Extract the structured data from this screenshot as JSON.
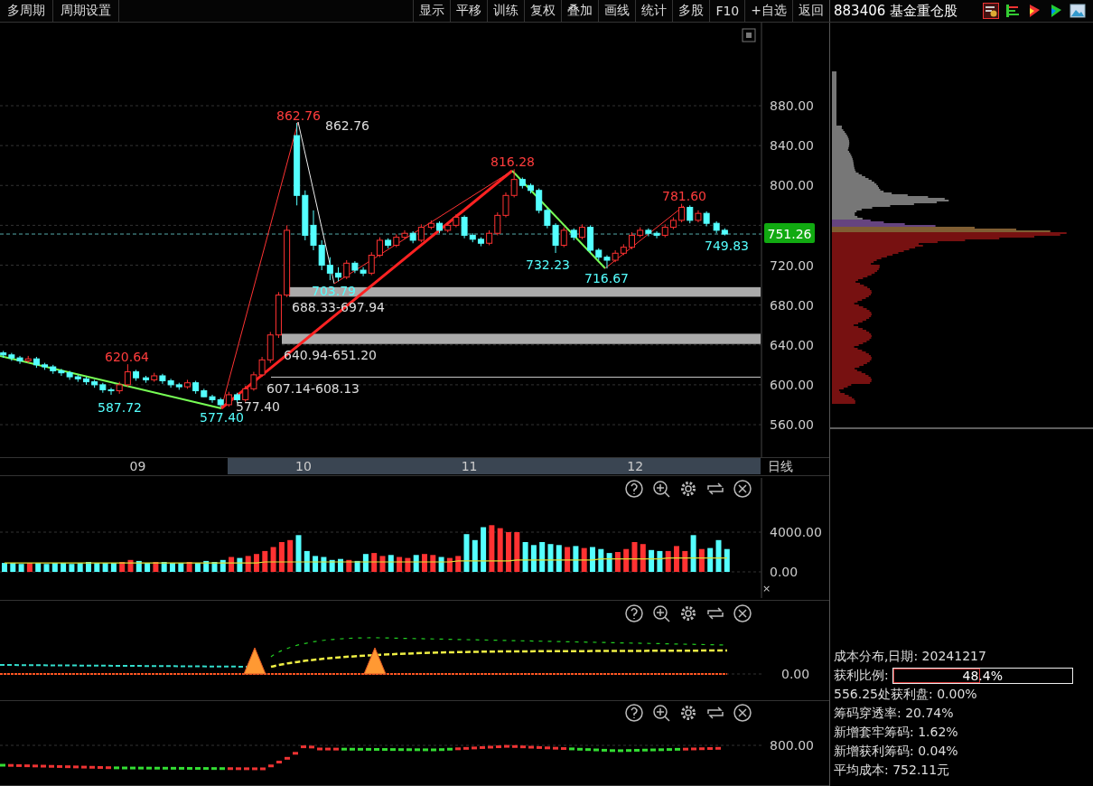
{
  "toolbar": {
    "left_items": [
      {
        "label": "多周期"
      },
      {
        "label": "周期设置"
      }
    ],
    "buttons": [
      "显示",
      "平移",
      "训练",
      "复权",
      "叠加",
      "画线",
      "统计",
      "多股",
      "F10",
      "+自选",
      "返回"
    ],
    "security": {
      "code": "883406",
      "name": "基金重仓股"
    }
  },
  "price_panel": {
    "chart_data": {
      "type": "candlestick",
      "x": [
        8.19,
        8.24,
        8.29,
        8.34,
        8.39,
        8.44,
        8.49,
        8.54,
        8.59,
        8.64,
        8.69,
        8.74,
        8.79,
        8.84,
        8.89,
        8.94,
        8.99,
        9.05,
        9.1,
        9.15,
        9.2,
        9.25,
        9.3,
        9.35,
        9.4,
        9.45,
        9.5,
        9.55,
        9.6,
        9.65,
        9.7,
        9.75,
        9.8,
        9.85,
        9.9,
        9.96,
        10.01,
        10.06,
        10.11,
        10.16,
        10.21,
        10.26,
        10.31,
        10.36,
        10.41,
        10.46,
        10.51,
        10.56,
        10.61,
        10.66,
        10.71,
        10.77,
        10.82,
        10.87,
        10.92,
        10.97,
        11.02,
        11.07,
        11.12,
        11.17,
        11.22,
        11.27,
        11.32,
        11.37,
        11.42,
        11.47,
        11.52,
        11.57,
        11.63,
        11.68,
        11.73,
        11.78,
        11.83,
        11.88,
        11.93,
        11.98,
        12.03,
        12.08,
        12.13,
        12.18,
        12.23,
        12.28,
        12.33,
        12.38,
        12.43,
        12.49,
        12.54
      ],
      "ohlc": [
        [
          632,
          634,
          627,
          630
        ],
        [
          630,
          632,
          624,
          627
        ],
        [
          627,
          629,
          621,
          624
        ],
        [
          624,
          629,
          622,
          626
        ],
        [
          626,
          628,
          617,
          620
        ],
        [
          620,
          622,
          615,
          618
        ],
        [
          618,
          620,
          611,
          614
        ],
        [
          614,
          616,
          609,
          612
        ],
        [
          612,
          614,
          605,
          608
        ],
        [
          608,
          610,
          603,
          606
        ],
        [
          606,
          608,
          600,
          603
        ],
        [
          603,
          605,
          597,
          600
        ],
        [
          600,
          602,
          592,
          595
        ],
        [
          595,
          597,
          590,
          594
        ],
        [
          594,
          603,
          591,
          600
        ],
        [
          600,
          620.64,
          598,
          613
        ],
        [
          613,
          615,
          604,
          607
        ],
        [
          607,
          609,
          602,
          605
        ],
        [
          605,
          612,
          603,
          609
        ],
        [
          609,
          611,
          601,
          604
        ],
        [
          604,
          606,
          597,
          600
        ],
        [
          600,
          602,
          595,
          598
        ],
        [
          598,
          605,
          596,
          602
        ],
        [
          602,
          604,
          591,
          594
        ],
        [
          594,
          596,
          587.72,
          588
        ],
        [
          588,
          590,
          582,
          585
        ],
        [
          585,
          587,
          577.4,
          580
        ],
        [
          580,
          593,
          578,
          590
        ],
        [
          590,
          592,
          582,
          585
        ],
        [
          585,
          599,
          583,
          596
        ],
        [
          596,
          613,
          594,
          610
        ],
        [
          610,
          628,
          608,
          625
        ],
        [
          625,
          653,
          622,
          650
        ],
        [
          650,
          693,
          647,
          690
        ],
        [
          690,
          760,
          688,
          755
        ],
        [
          850,
          862.76,
          780,
          790
        ],
        [
          790,
          795,
          745,
          750
        ],
        [
          760,
          775,
          735,
          740
        ],
        [
          740,
          745,
          715,
          720
        ],
        [
          720,
          728,
          705,
          712
        ],
        [
          712,
          718,
          703.79,
          708
        ],
        [
          708,
          725,
          706,
          722
        ],
        [
          722,
          724,
          712,
          715
        ],
        [
          715,
          718,
          709,
          712
        ],
        [
          712,
          733,
          710,
          730
        ],
        [
          730,
          748,
          728,
          745
        ],
        [
          745,
          747,
          737,
          740
        ],
        [
          740,
          751,
          738,
          748
        ],
        [
          748,
          755,
          746,
          752
        ],
        [
          752,
          754,
          742,
          745
        ],
        [
          745,
          761,
          743,
          758
        ],
        [
          758,
          765,
          756,
          762
        ],
        [
          762,
          764,
          752,
          755
        ],
        [
          755,
          763,
          753,
          760
        ],
        [
          760,
          771,
          758,
          768
        ],
        [
          768,
          770,
          747,
          750
        ],
        [
          750,
          752,
          743,
          746
        ],
        [
          746,
          748,
          739,
          742
        ],
        [
          742,
          755,
          740,
          752
        ],
        [
          752,
          773,
          750,
          770
        ],
        [
          770,
          793,
          768,
          790
        ],
        [
          790,
          816.28,
          788,
          806
        ],
        [
          806,
          808,
          797,
          800
        ],
        [
          800,
          802,
          792,
          795
        ],
        [
          795,
          797,
          772,
          775
        ],
        [
          775,
          777,
          757,
          760
        ],
        [
          760,
          762,
          732.23,
          740
        ],
        [
          740,
          758,
          738,
          755
        ],
        [
          755,
          757,
          745,
          748
        ],
        [
          748,
          761,
          746,
          758
        ],
        [
          758,
          760,
          732,
          735
        ],
        [
          735,
          737,
          725,
          728
        ],
        [
          728,
          730,
          716.67,
          725
        ],
        [
          725,
          735,
          723,
          732
        ],
        [
          732,
          741,
          730,
          738
        ],
        [
          738,
          753,
          736,
          750
        ],
        [
          750,
          758,
          748,
          755
        ],
        [
          755,
          757,
          749,
          752
        ],
        [
          752,
          754,
          747,
          750
        ],
        [
          750,
          761,
          748,
          758
        ],
        [
          758,
          768,
          756,
          765
        ],
        [
          765,
          781.6,
          763,
          778
        ],
        [
          778,
          780,
          762,
          765
        ],
        [
          765,
          775,
          763,
          772
        ],
        [
          772,
          774,
          759,
          762
        ],
        [
          762,
          764,
          752,
          755
        ],
        [
          755,
          757,
          749.83,
          751.26
        ]
      ],
      "xlim": [
        8.17,
        13.17
      ],
      "ylim": [
        527.4,
        963.4
      ],
      "xticks": [
        {
          "value": 9,
          "label": "09"
        },
        {
          "value": 10,
          "label": "10"
        },
        {
          "value": 11,
          "label": "11"
        },
        {
          "value": 12,
          "label": "12"
        }
      ],
      "yticks": [
        {
          "value": 880,
          "label": "880.00"
        },
        {
          "value": 840,
          "label": "840.00"
        },
        {
          "value": 800,
          "label": "800.00"
        },
        {
          "value": 720,
          "label": "720.00"
        },
        {
          "value": 680,
          "label": "680.00"
        },
        {
          "value": 640,
          "label": "640.00"
        },
        {
          "value": 600,
          "label": "600.00"
        },
        {
          "value": 560,
          "label": "560.00"
        }
      ],
      "grid": true,
      "bands": [
        {
          "axis": "y",
          "from": 688.33,
          "to": 697.94
        },
        {
          "axis": "y",
          "from": 640.94,
          "to": 651.2
        },
        {
          "axis": "y",
          "from": 607.14,
          "to": 608.13
        }
      ],
      "ref_lines": [
        {
          "axis": "y",
          "value": 751.26
        }
      ]
    },
    "current_price": "751.26",
    "annotations": [
      {
        "text": "862.76",
        "kind": "high"
      },
      {
        "text": "862.76",
        "kind": "level"
      },
      {
        "text": "816.28",
        "kind": "high"
      },
      {
        "text": "781.60",
        "kind": "high"
      },
      {
        "text": "749.83",
        "kind": "low"
      },
      {
        "text": "732.23",
        "kind": "low"
      },
      {
        "text": "716.67",
        "kind": "low"
      },
      {
        "text": "703.79",
        "kind": "low"
      },
      {
        "text": "688.33-697.94",
        "kind": "level"
      },
      {
        "text": "640.94-651.20",
        "kind": "level"
      },
      {
        "text": "620.64",
        "kind": "high"
      },
      {
        "text": "607.14-608.13",
        "kind": "level"
      },
      {
        "text": "587.72",
        "kind": "low"
      },
      {
        "text": "577.40",
        "kind": "low"
      },
      {
        "text": "577.40",
        "kind": "level"
      }
    ]
  },
  "time_axis": {
    "period": "日线"
  },
  "volume_panel": {
    "chart_data": {
      "type": "bar",
      "series": [
        {
          "color": "#ff3232",
          "values": [
            null,
            null,
            null,
            900,
            null,
            null,
            null,
            null,
            null,
            null,
            null,
            null,
            null,
            null,
            1000,
            1200,
            null,
            null,
            1000,
            null,
            null,
            null,
            1000,
            null,
            null,
            null,
            null,
            1500,
            null,
            1600,
            1800,
            2100,
            2500,
            3000,
            3200,
            null,
            null,
            null,
            null,
            null,
            null,
            1200,
            null,
            null,
            1900,
            1600,
            null,
            1500,
            1400,
            null,
            1800,
            1700,
            null,
            1400,
            1600,
            null,
            null,
            null,
            4700,
            4400,
            4000,
            4000,
            null,
            null,
            null,
            null,
            null,
            2500,
            null,
            2400,
            null,
            null,
            null,
            2000,
            2300,
            3000,
            2800,
            null,
            null,
            2100,
            2600,
            2100,
            null,
            2300,
            null,
            null,
            null
          ]
        },
        {
          "color": "#54ffff",
          "values": [
            900,
            900,
            800,
            null,
            900,
            800,
            900,
            900,
            800,
            900,
            1000,
            900,
            900,
            900,
            null,
            null,
            1100,
            900,
            null,
            1000,
            900,
            900,
            null,
            900,
            1100,
            1000,
            1200,
            null,
            1400,
            null,
            null,
            null,
            null,
            null,
            null,
            3700,
            2100,
            1600,
            1500,
            1200,
            1300,
            null,
            1100,
            1800,
            null,
            null,
            1700,
            null,
            null,
            1700,
            null,
            null,
            1500,
            null,
            null,
            3800,
            3200,
            4500,
            null,
            null,
            null,
            null,
            3000,
            2700,
            3000,
            2800,
            2700,
            null,
            2600,
            null,
            2500,
            2300,
            1900,
            null,
            null,
            null,
            null,
            2200,
            2100,
            null,
            null,
            null,
            3700,
            null,
            2400,
            3200,
            2300
          ]
        },
        {
          "type": "line",
          "color": "#dddd33",
          "values": [
            900,
            900,
            900,
            900,
            900,
            900,
            900,
            900,
            900,
            900,
            900,
            900,
            900,
            900,
            900,
            900,
            900,
            900,
            900,
            900,
            900,
            900,
            900,
            900,
            900,
            900,
            900,
            900,
            900,
            900,
            900,
            1000,
            1000,
            1000,
            1000,
            1000,
            1000,
            1000,
            1000,
            1000,
            1000,
            1000,
            1000,
            1000,
            1000,
            1000,
            1000,
            1000,
            1000,
            1000,
            1000,
            1000,
            1000,
            1000,
            1100,
            1100,
            1100,
            1100,
            1100,
            1100,
            1100,
            1200,
            1200,
            1200,
            1200,
            1200,
            1200,
            1200,
            1200,
            1200,
            1200,
            1300,
            1300,
            1300,
            1300,
            1300,
            1300,
            1300,
            1300,
            1400,
            1400,
            1400,
            1400,
            1400,
            1400,
            1400,
            1400
          ]
        }
      ],
      "ylim": [
        -2638,
        9458
      ],
      "yticks": [
        {
          "value": 4000,
          "label": "4000.00"
        },
        {
          "value": 0,
          "label": "0.00"
        }
      ]
    },
    "corner_mark": "×"
  },
  "indicator_panel": {
    "axis": [
      "0.00"
    ]
  },
  "bottom_panel": {
    "axis": [
      "800.00"
    ]
  },
  "info": {
    "title": "成本分布,日期: 20241217",
    "profit_ratio": {
      "label": "获利比例:",
      "value": "48.4%",
      "level": 0.484
    },
    "lines": [
      "556.25处获利盘: 0.00%",
      "筹码穿透率: 20.74%",
      "新增套牢筹码: 1.62%",
      "新增获利筹码: 0.04%",
      "平均成本: 752.11元"
    ]
  }
}
